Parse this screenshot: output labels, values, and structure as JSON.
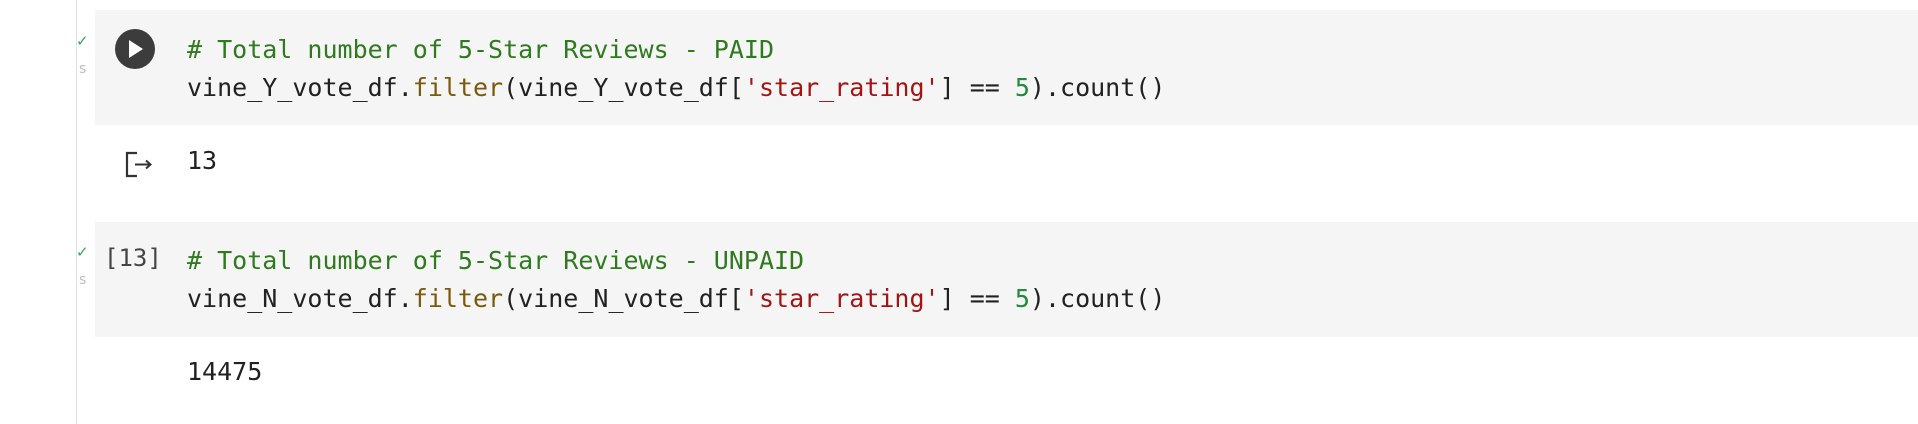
{
  "cells": [
    {
      "status": {
        "check": "✓",
        "suffix": "s"
      },
      "run_button_icon": "play-icon",
      "comment": "# Total number of 5-Star Reviews - PAID",
      "code": {
        "var": "vine_Y_vote_df",
        "dot_filter": ".",
        "method_filter": "filter",
        "open_paren_var": "(vine_Y_vote_df[",
        "string": "'star_rating'",
        "mid": "] == ",
        "number": "5",
        "tail": ").count()"
      },
      "output_icon": "output-redirect-icon",
      "output": "13"
    },
    {
      "status": {
        "check": "✓",
        "suffix": "s"
      },
      "execution_count": "[13]",
      "comment": "# Total number of 5-Star Reviews - UNPAID",
      "code": {
        "var": "vine_N_vote_df",
        "dot_filter": ".",
        "method_filter": "filter",
        "open_paren_var": "(vine_N_vote_df[",
        "string": "'star_rating'",
        "mid": "] == ",
        "number": "5",
        "tail": ").count()"
      },
      "output": "14475"
    }
  ],
  "colors": {
    "comment": "#2f7a1f",
    "method": "#7a5b0e",
    "string": "#a31515",
    "number": "#228b3c",
    "cell_background": "#f5f5f5",
    "status_check": "#3aa757"
  }
}
